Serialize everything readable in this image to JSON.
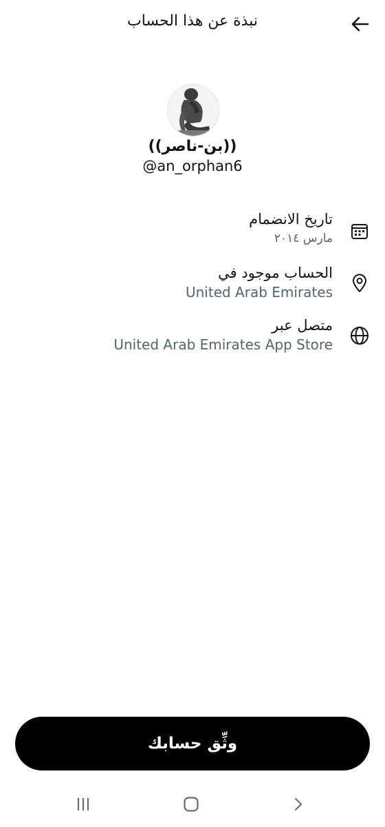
{
  "header": {
    "title": "نبذة عن هذا الحساب",
    "back_icon": "arrow-back-icon"
  },
  "profile": {
    "display_name": "((بن-ناصر))",
    "handle": "@an_orphan6",
    "avatar": "thinker-statue-avatar"
  },
  "info": [
    {
      "label": "تاريخ الانضمام",
      "value": "مارس ٢٠١٤",
      "icon": "calendar-icon"
    },
    {
      "label": "الحساب موجود في",
      "value": "United Arab Emirates",
      "icon": "location-pin-icon"
    },
    {
      "label": "متصل عبر",
      "value": "United Arab Emirates App Store",
      "icon": "globe-icon"
    }
  ],
  "verify_button": {
    "label": "وثِّق حسابك"
  },
  "nav": {
    "recents_icon": "recent-apps-icon",
    "home_icon": "home-icon",
    "back_icon": "nav-back-icon"
  },
  "colors": {
    "text_primary": "#0f1419",
    "text_secondary": "#536471",
    "button_bg": "#000000",
    "button_text": "#ffffff",
    "nav_icon": "#6b6b6b"
  }
}
